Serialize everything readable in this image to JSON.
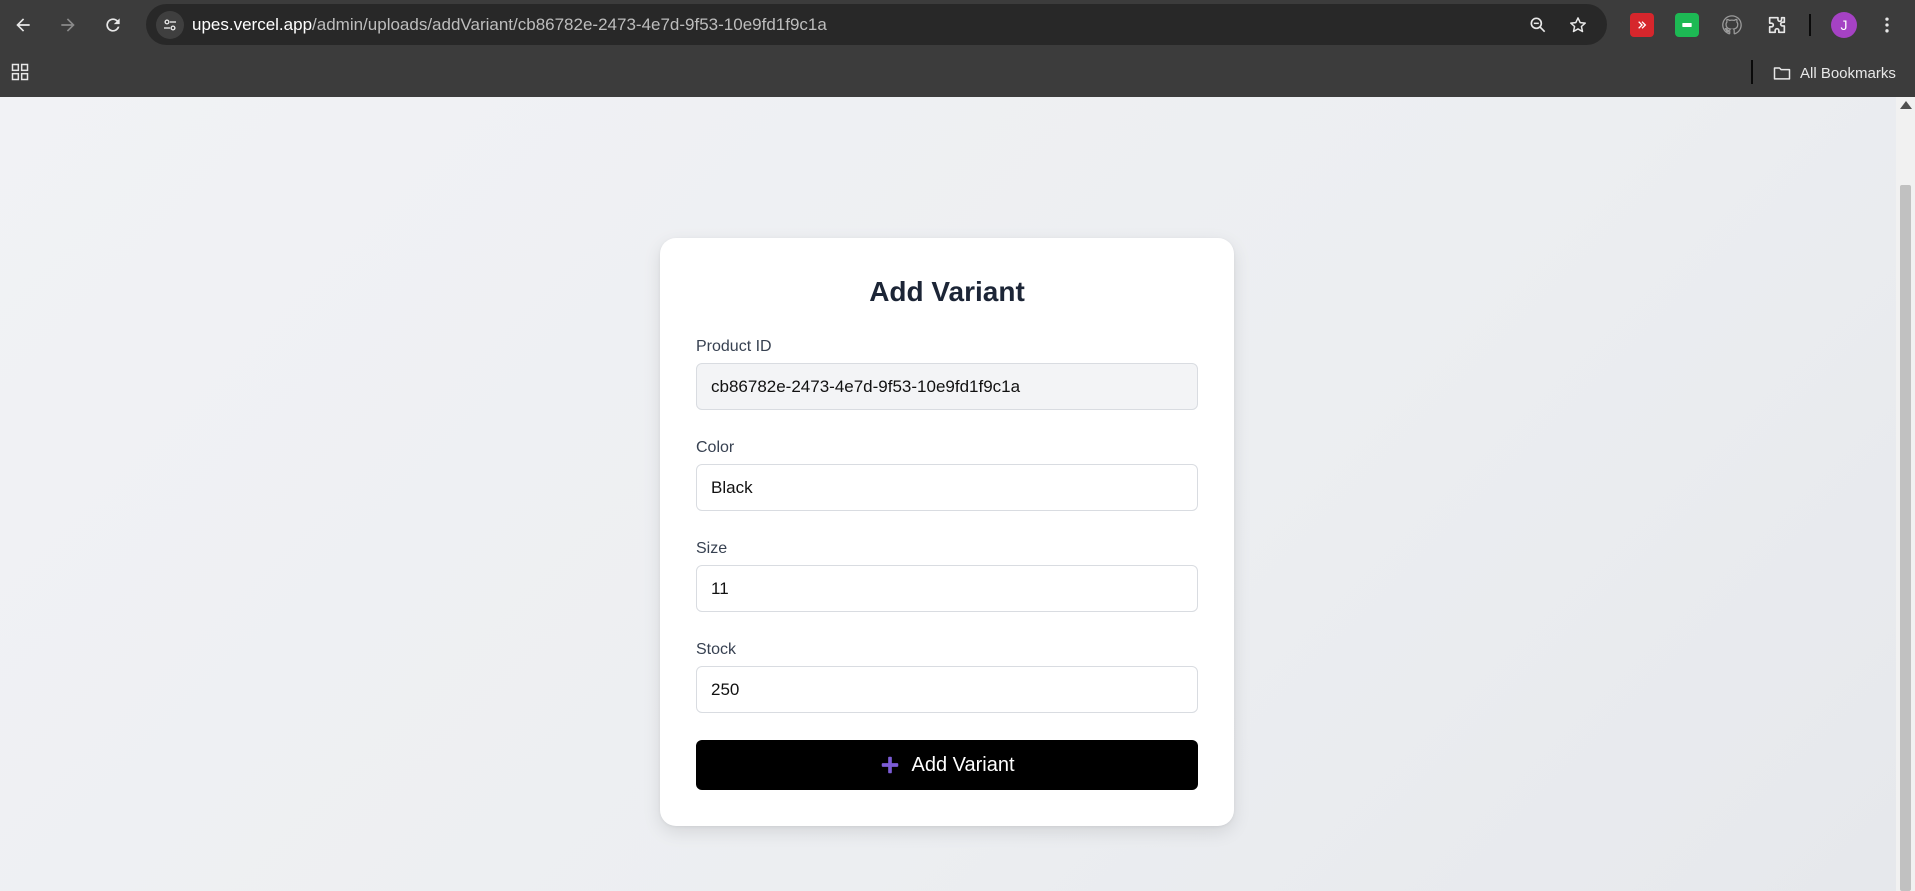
{
  "browser": {
    "url_host": "upes.vercel.app",
    "url_path": "/admin/uploads/addVariant/cb86782e-2473-4e7d-9f53-10e9fd1f9c1a",
    "avatar_letter": "J",
    "all_bookmarks_label": "All Bookmarks",
    "extensions": [
      "red-extension-icon",
      "green-extension-icon",
      "github-extension-icon"
    ]
  },
  "form": {
    "title": "Add Variant",
    "fields": [
      {
        "label": "Product ID",
        "value": "cb86782e-2473-4e7d-9f53-10e9fd1f9c1a",
        "readonly": true
      },
      {
        "label": "Color",
        "value": "Black"
      },
      {
        "label": "Size",
        "value": "11"
      },
      {
        "label": "Stock",
        "value": "250"
      }
    ],
    "submit_label": "Add Variant",
    "submit_icon": "plus-icon"
  },
  "colors": {
    "chrome": "#3c3c3c",
    "button": "#000000",
    "plus_icon": "#7c5cd6"
  }
}
